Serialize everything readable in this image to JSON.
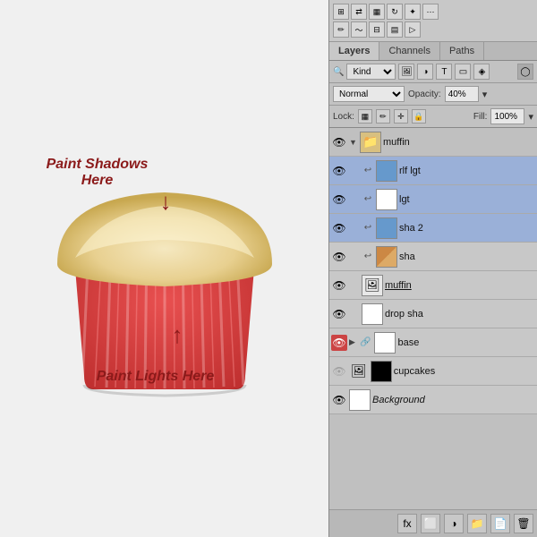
{
  "panel": {
    "tabs": [
      {
        "label": "Layers",
        "active": true
      },
      {
        "label": "Channels",
        "active": false
      },
      {
        "label": "Paths",
        "active": false
      }
    ],
    "filter": {
      "label": "Kind",
      "icons": [
        "img-icon",
        "adjust-icon",
        "type-icon",
        "shape-icon",
        "smart-icon"
      ]
    },
    "blend": {
      "mode": "Normal",
      "opacity_label": "Opacity:",
      "opacity_value": "40%"
    },
    "lock": {
      "label": "Lock:",
      "icons": [
        "checkerboard-icon",
        "brush-icon",
        "move-icon",
        "lock-icon"
      ],
      "fill_label": "Fill:",
      "fill_value": "100%"
    },
    "layers": [
      {
        "id": "muffin-group",
        "name": "muffin",
        "type": "group",
        "visible": true,
        "selected": false,
        "indent": 0,
        "expanded": true
      },
      {
        "id": "rlf-lgt",
        "name": "rlf lgt",
        "type": "normal",
        "visible": true,
        "selected": true,
        "indent": 1,
        "has_link": true,
        "thumb": "blue"
      },
      {
        "id": "lgt",
        "name": "lgt",
        "type": "normal",
        "visible": true,
        "selected": true,
        "indent": 1,
        "has_link": true,
        "thumb": "white"
      },
      {
        "id": "sha2",
        "name": "sha 2",
        "type": "normal",
        "visible": true,
        "selected": true,
        "indent": 1,
        "has_link": true,
        "thumb": "blue"
      },
      {
        "id": "sha",
        "name": "sha",
        "type": "normal",
        "visible": true,
        "selected": false,
        "indent": 1,
        "has_link": true,
        "thumb": "orange"
      },
      {
        "id": "muffin-layer",
        "name": "muffin",
        "type": "smart",
        "visible": true,
        "selected": false,
        "indent": 1
      },
      {
        "id": "drop-sha",
        "name": "drop sha",
        "type": "normal",
        "visible": true,
        "selected": false,
        "indent": 1,
        "thumb": "white"
      },
      {
        "id": "base",
        "name": "base",
        "type": "group",
        "visible": true,
        "selected": false,
        "indent": 0,
        "eye_red": true,
        "has_mask": true
      },
      {
        "id": "cupcakes",
        "name": "cupcakes",
        "type": "smart-group",
        "visible": false,
        "selected": false,
        "indent": 0,
        "has_black_thumb": true
      },
      {
        "id": "background",
        "name": "Background",
        "type": "background",
        "visible": true,
        "selected": false,
        "indent": 0,
        "thumb": "white",
        "italic": true
      }
    ],
    "bottom_buttons": [
      "fx-btn",
      "mask-btn",
      "adjustment-btn",
      "group-btn",
      "new-layer-btn",
      "delete-btn"
    ]
  },
  "canvas": {
    "paint_shadows_label": "Paint Shadows Here",
    "paint_lights_label": "Paint Lights Here"
  },
  "toolbar": {
    "top_row": [
      "grid-icon",
      "arrange-icon",
      "layers-icon",
      "rotate-icon",
      "star-icon",
      "dots-icon"
    ],
    "bottom_row": [
      "pencil-icon",
      "wave-icon",
      "brush-icon",
      "grid2-icon",
      "triangle-icon"
    ]
  }
}
